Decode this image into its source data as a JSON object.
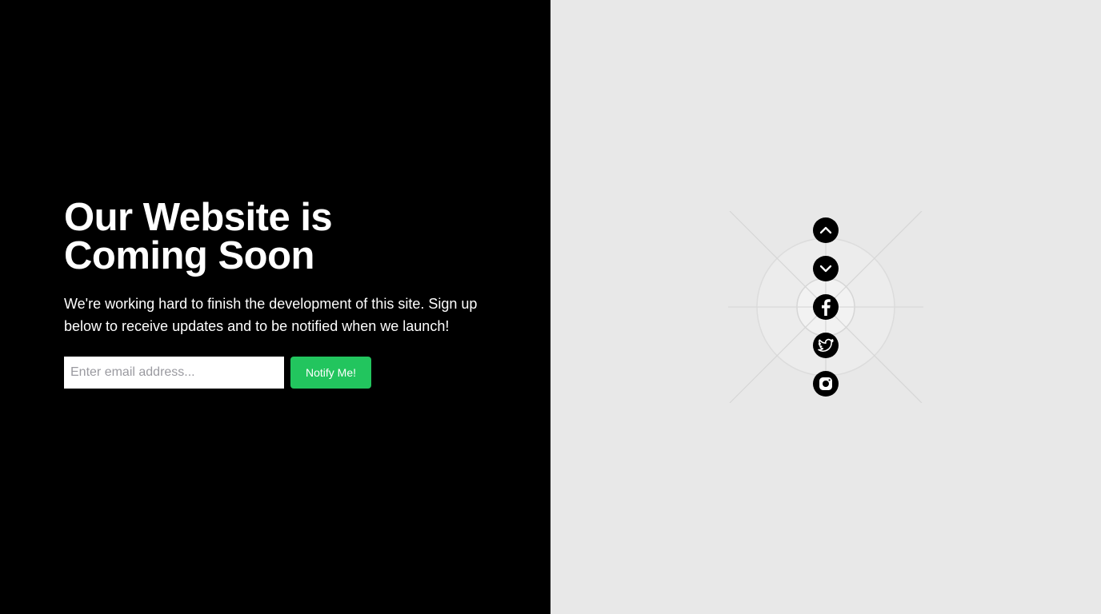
{
  "hero": {
    "title": "Our Website is Coming Soon",
    "description": "We're working hard to finish the development of this site. Sign up below to receive updates and to be notified when we launch!"
  },
  "signup": {
    "email_placeholder": "Enter email address...",
    "email_value": "",
    "button_label": "Notify Me!"
  },
  "social": {
    "icons": [
      "chevron-up-icon",
      "chevron-down-icon",
      "facebook-icon",
      "twitter-icon",
      "instagram-icon"
    ]
  },
  "colors": {
    "left_background": "#000000",
    "right_background": "#e8e8e8",
    "accent": "#22c55e",
    "text": "#ffffff"
  }
}
